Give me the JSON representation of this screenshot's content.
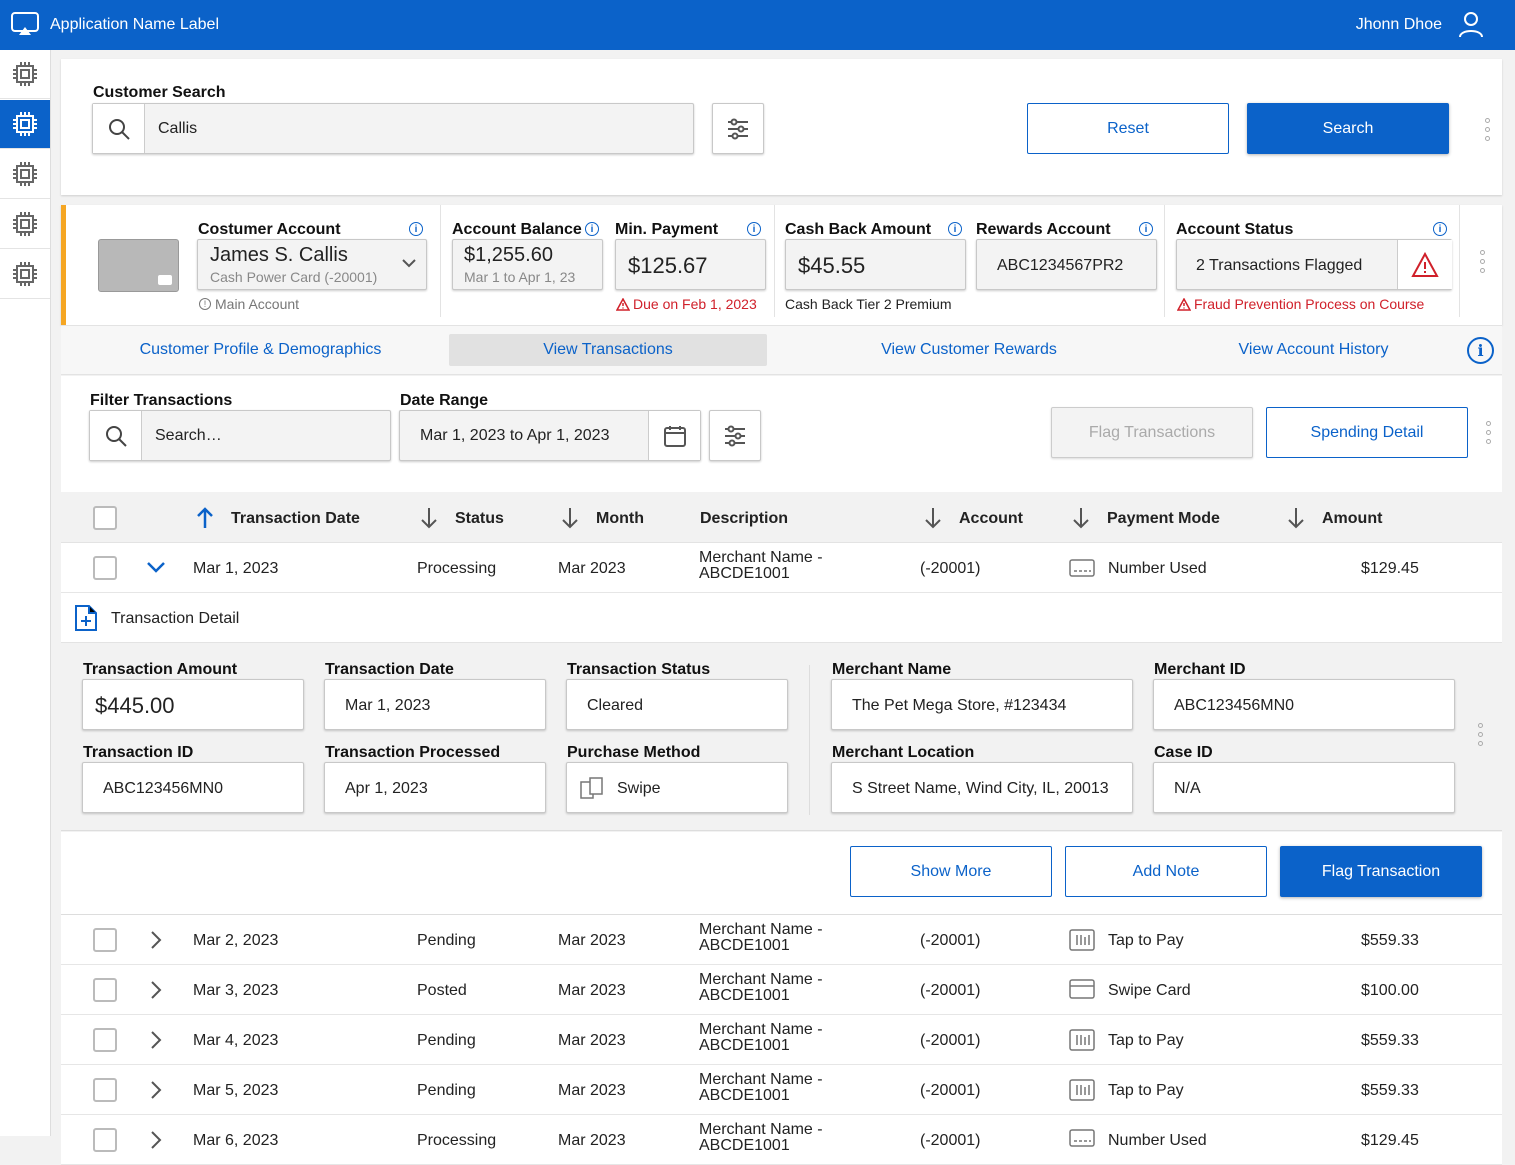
{
  "app": {
    "name": "Application Name Label",
    "user": "Jhonn Dhoe"
  },
  "search": {
    "label": "Customer Search",
    "value": "Callis",
    "reset": "Reset",
    "search": "Search"
  },
  "account": {
    "customer_label": "Costumer Account",
    "customer_name": "James S. Callis",
    "card": "Cash Power Card (-20001)",
    "main": "Main Account",
    "balance_label": "Account Balance",
    "balance": "$1,255.60",
    "balance_period": "Mar 1 to Apr 1, 23",
    "min_label": "Min. Payment",
    "min": "$125.67",
    "due": "Due on Feb 1, 2023",
    "cashback_label": "Cash Back Amount",
    "cashback": "$45.55",
    "tier": "Cash Back Tier 2 Premium",
    "rewards_label": "Rewards Account",
    "rewards": "ABC1234567PR2",
    "status_label": "Account Status",
    "status": "2 Transactions Flagged",
    "fraud": "Fraud Prevention Process on Course"
  },
  "tabs": [
    "Customer Profile & Demographics",
    "View Transactions",
    "View Customer Rewards",
    "View Account History"
  ],
  "filter": {
    "label": "Filter Transactions",
    "placeholder": "Search…",
    "date_label": "Date Range",
    "date": "Mar 1, 2023 to Apr 1, 2023",
    "flag": "Flag Transactions",
    "spending": "Spending Detail"
  },
  "columns": [
    "Transaction Date",
    "Status",
    "Month",
    "Description",
    "Account",
    "Payment Mode",
    "Amount"
  ],
  "first_row": {
    "date": "Mar 1, 2023",
    "status": "Processing",
    "month": "Mar 2023",
    "desc1": "Merchant Name -",
    "desc2": "ABCDE1001",
    "account": "(-20001)",
    "mode": "Number Used",
    "amount": "$129.45"
  },
  "detail": {
    "title": "Transaction Detail",
    "amount_label": "Transaction Amount",
    "amount": "$445.00",
    "date_label": "Transaction Date",
    "date": "Mar 1, 2023",
    "status_label": "Transaction Status",
    "status": "Cleared",
    "merchant_label": "Merchant Name",
    "merchant": "The Pet Mega Store, #123434",
    "mid_label": "Merchant ID",
    "mid": "ABC123456MN0",
    "tid_label": "Transaction ID",
    "tid": "ABC123456MN0",
    "processed_label": "Transaction Processed",
    "processed": "Apr 1, 2023",
    "method_label": "Purchase Method",
    "method": "Swipe",
    "location_label": "Merchant Location",
    "location": "S Street Name, Wind City, IL, 20013",
    "case_label": "Case ID",
    "case": "N/A",
    "show_more": "Show More",
    "add_note": "Add Note",
    "flag": "Flag Transaction"
  },
  "rows": [
    {
      "date": "Mar 2, 2023",
      "status": "Pending",
      "month": "Mar 2023",
      "desc1": "Merchant Name -",
      "desc2": "ABCDE1001",
      "account": "(-20001)",
      "mode": "Tap to Pay",
      "icon": "tap-icon",
      "amount": "$559.33"
    },
    {
      "date": "Mar 3, 2023",
      "status": "Posted",
      "month": "Mar 2023",
      "desc1": "Merchant Name -",
      "desc2": "ABCDE1001",
      "account": "(-20001)",
      "mode": "Swipe Card",
      "icon": "card-icon",
      "amount": "$100.00"
    },
    {
      "date": "Mar 4, 2023",
      "status": "Pending",
      "month": "Mar 2023",
      "desc1": "Merchant Name -",
      "desc2": "ABCDE1001",
      "account": "(-20001)",
      "mode": "Tap to Pay",
      "icon": "tap-icon",
      "amount": "$559.33"
    },
    {
      "date": "Mar 5, 2023",
      "status": "Pending",
      "month": "Mar 2023",
      "desc1": "Merchant Name -",
      "desc2": "ABCDE1001",
      "account": "(-20001)",
      "mode": "Tap to Pay",
      "icon": "tap-icon",
      "amount": "$559.33"
    },
    {
      "date": "Mar 6, 2023",
      "status": "Processing",
      "month": "Mar 2023",
      "desc1": "Merchant Name -",
      "desc2": "ABCDE1001",
      "account": "(-20001)",
      "mode": "Number Used",
      "icon": "number-icon",
      "amount": "$129.45"
    }
  ],
  "colors": {
    "primary": "#0b62c9",
    "accent": "#f5a623",
    "alert": "#d0202a"
  }
}
